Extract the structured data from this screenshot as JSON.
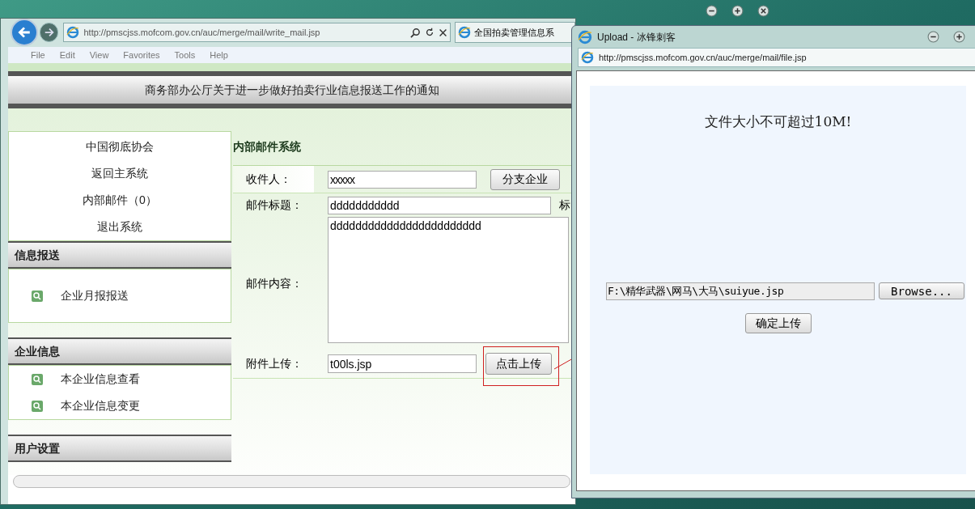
{
  "browser": {
    "url": "http://pmscjss.mofcom.gov.cn/auc/merge/mail/write_mail.jsp",
    "tab_title": "全国拍卖管理信息系",
    "menu": [
      "File",
      "Edit",
      "View",
      "Favorites",
      "Tools",
      "Help"
    ]
  },
  "page": {
    "title": "商务部办公厅关于进一步做好拍卖行业信息报送工作的通知",
    "sidebar": {
      "org": "中国彻底协会",
      "links": [
        "返回主系统",
        "内部邮件（0）",
        "退出系统"
      ],
      "sections": [
        {
          "title": "信息报送",
          "items": [
            "企业月报报送"
          ]
        },
        {
          "title": "企业信息",
          "items": [
            "本企业信息查看",
            "本企业信息变更"
          ]
        },
        {
          "title": "用户设置"
        }
      ]
    },
    "form": {
      "heading": "内部邮件系统",
      "recipient": {
        "label": "收件人：",
        "value": "xxxxx",
        "button": "分支企业"
      },
      "subject": {
        "label": "邮件标题：",
        "value": "ddddddddddd",
        "trailing": "标"
      },
      "body": {
        "label": "邮件内容：",
        "value": "dddddddddddddddddddddddd"
      },
      "attachment": {
        "label": "附件上传：",
        "value": "t00ls.jsp",
        "button": "点击上传"
      }
    }
  },
  "popup": {
    "title": "Upload - 冰锋刺客",
    "url": "http://pmscjss.mofcom.gov.cn/auc/merge/mail/file.jsp",
    "notice": "文件大小不可超过10M!",
    "file": {
      "value": "F:\\精华武器\\网马\\大马\\suiyue.jsp",
      "button": "Browse..."
    },
    "submit": "确定上传"
  }
}
